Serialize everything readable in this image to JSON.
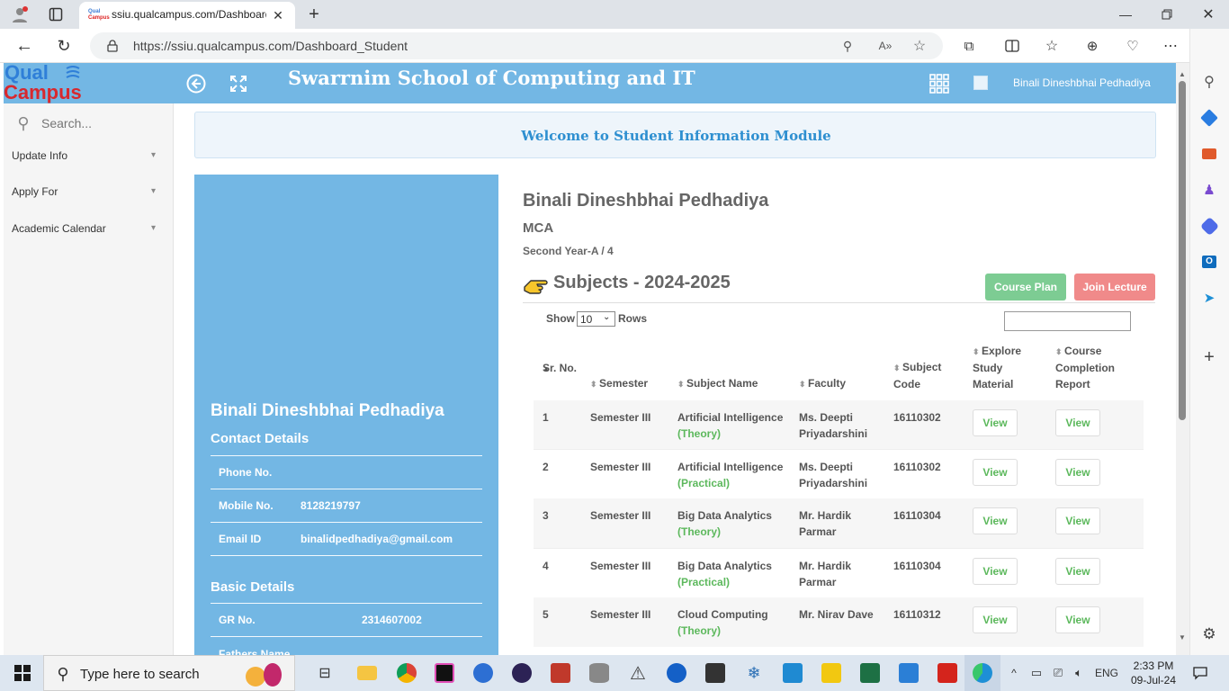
{
  "browser": {
    "tab_title": "ssiu.qualcampus.com/Dashboard_",
    "url": "https://ssiu.qualcampus.com/Dashboard_Student"
  },
  "app": {
    "logo_line1": "Qual",
    "logo_line2": "Campus",
    "school_title": "Swarrnim School of Computing and IT",
    "user_name": "Binali Dineshbhai Pedhadiya",
    "welcome": "Welcome to Student Information Module"
  },
  "sidebar": {
    "search_placeholder": "Search...",
    "items": [
      {
        "label": "Update Info"
      },
      {
        "label": "Apply For"
      },
      {
        "label": "Academic Calendar"
      }
    ]
  },
  "profile": {
    "name": "Binali Dineshbhai Pedhadiya",
    "contact_heading": "Contact Details",
    "phone_label": "Phone No.",
    "phone_value": "",
    "mobile_label": "Mobile No.",
    "mobile_value": "8128219797",
    "email_label": "Email ID",
    "email_value": "binalidpedhadiya@gmail.com",
    "basic_heading": "Basic Details",
    "gr_label": "GR No.",
    "gr_value": "2314607002",
    "father_label": "Fathers Name"
  },
  "student": {
    "name": "Binali Dineshbhai Pedhadiya",
    "program": "MCA",
    "year": "Second Year-A / 4"
  },
  "subjects": {
    "heading": "Subjects - 2024-2025",
    "course_plan": "Course Plan",
    "join_lecture": "Join Lecture",
    "show_label": "Show",
    "rows_label": "Rows",
    "page_size": "10",
    "headers": {
      "sr": "Sr. No.",
      "semester": "Semester",
      "subject": "Subject Name",
      "faculty": "Faculty",
      "code": "Subject Code",
      "explore": "Explore Study Material",
      "completion": "Course Completion Report"
    },
    "rows": [
      {
        "sr": "1",
        "semester": "Semester III",
        "subject": "Artificial Intelligence",
        "type": "(Theory)",
        "faculty": "Ms. Deepti Priyadarshini",
        "code": "16110302",
        "view1": "View",
        "view2": "View"
      },
      {
        "sr": "2",
        "semester": "Semester III",
        "subject": "Artificial Intelligence",
        "type": "(Practical)",
        "faculty": "Ms. Deepti Priyadarshini",
        "code": "16110302",
        "view1": "View",
        "view2": "View"
      },
      {
        "sr": "3",
        "semester": "Semester III",
        "subject": "Big Data Analytics",
        "type": "(Theory)",
        "faculty": "Mr. Hardik Parmar",
        "code": "16110304",
        "view1": "View",
        "view2": "View"
      },
      {
        "sr": "4",
        "semester": "Semester III",
        "subject": "Big Data Analytics",
        "type": "(Practical)",
        "faculty": "Mr. Hardik Parmar",
        "code": "16110304",
        "view1": "View",
        "view2": "View"
      },
      {
        "sr": "5",
        "semester": "Semester III",
        "subject": "Cloud Computing",
        "type": "(Theory)",
        "faculty": "Mr. Nirav Dave",
        "code": "16110312",
        "view1": "View",
        "view2": "View"
      }
    ]
  },
  "taskbar": {
    "search_placeholder": "Type here to search",
    "lang": "ENG",
    "time": "2:33 PM",
    "date": "09-Jul-24"
  },
  "colors": {
    "header_blue": "#73b7e4",
    "course_plan_green": "#7dcc93",
    "join_lecture_red": "#f08a8a",
    "view_green": "#5cb85c"
  }
}
